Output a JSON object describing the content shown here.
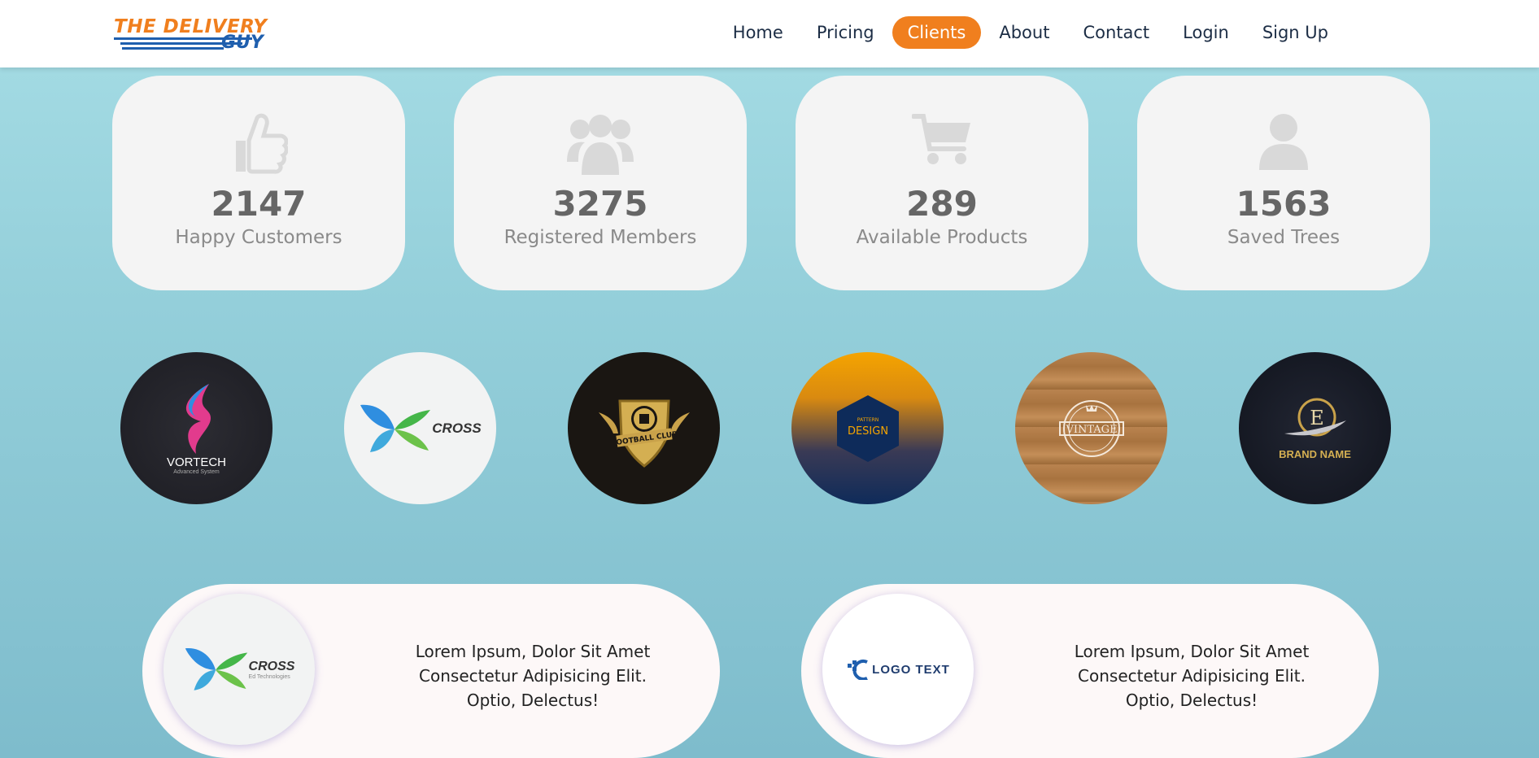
{
  "brand": {
    "line1": "THE DELIVERY",
    "line2": "GUY",
    "colors": {
      "orange": "#f07f1e",
      "blue": "#1f5fae"
    }
  },
  "nav": {
    "items": [
      "Home",
      "Pricing",
      "Clients",
      "About",
      "Contact",
      "Login",
      "Sign Up"
    ],
    "active": "Clients"
  },
  "stats": [
    {
      "icon": "thumbs-up-icon",
      "value": "2147",
      "label": "Happy Customers"
    },
    {
      "icon": "users-group-icon",
      "value": "3275",
      "label": "Registered Members"
    },
    {
      "icon": "shopping-cart-icon",
      "value": "289",
      "label": "Available Products"
    },
    {
      "icon": "user-icon",
      "value": "1563",
      "label": "Saved Trees"
    }
  ],
  "clients": [
    {
      "name": "VORTECH",
      "tagline": "Advanced System"
    },
    {
      "name": "CROSS",
      "tagline": "Ed Technologies"
    },
    {
      "name": "FOOTBALL CLUB"
    },
    {
      "name": "DESIGN",
      "tagline": "PATTERN"
    },
    {
      "name": "VINTAGE"
    },
    {
      "name": "BRAND NAME",
      "tagline": "E"
    }
  ],
  "testimonials": [
    {
      "logo": "CROSS",
      "logo_tagline": "Ed Technologies",
      "text": "Lorem Ipsum, Dolor Sit Amet Consectetur Adipisicing Elit. Optio, Delectus!"
    },
    {
      "logo": "LOGO TEXT",
      "text": "Lorem Ipsum, Dolor Sit Amet Consectetur Adipisicing Elit. Optio, Delectus!"
    }
  ]
}
